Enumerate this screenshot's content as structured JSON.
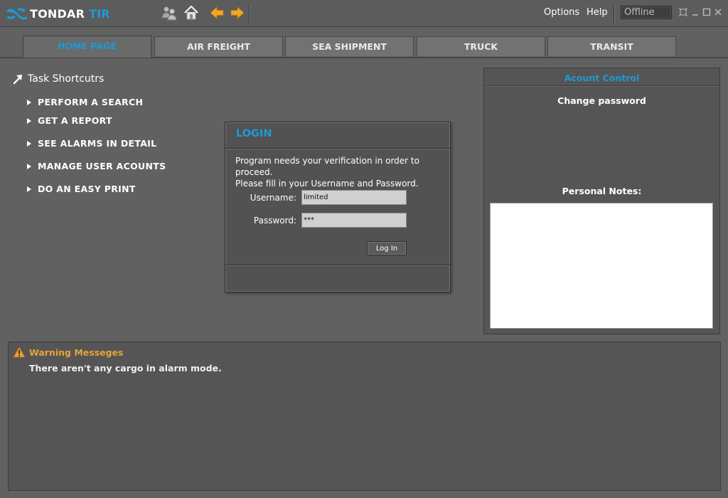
{
  "app": {
    "brand_primary": "TONDAR",
    "brand_secondary": "TIR"
  },
  "toolbar": {
    "icons": [
      "users-icon",
      "home-icon",
      "back-arrow-icon",
      "forward-arrow-icon"
    ]
  },
  "menu": {
    "options": "Options",
    "help": "Help"
  },
  "status": {
    "connection": "Offline"
  },
  "tabs": [
    {
      "label": "HOME PAGE",
      "active": true
    },
    {
      "label": "AIR FREIGHT",
      "active": false
    },
    {
      "label": "SEA SHIPMENT",
      "active": false
    },
    {
      "label": "TRUCK",
      "active": false
    },
    {
      "label": "TRANSIT",
      "active": false
    }
  ],
  "shortcuts": {
    "title": "Task Shortcutrs",
    "items": [
      {
        "label": "PERFORM A SEARCH"
      },
      {
        "label": "GET A REPORT"
      },
      {
        "label": "SEE ALARMS IN DETAIL"
      },
      {
        "label": "MANAGE USER ACOUNTS"
      },
      {
        "label": "DO AN EASY PRINT"
      }
    ]
  },
  "account": {
    "title": "Acount Control",
    "change_password": "Change password",
    "notes_label": "Personal Notes:",
    "notes_value": ""
  },
  "warnings": {
    "title": "Warning Messeges",
    "message": "There aren't any cargo in alarm mode."
  },
  "login": {
    "title": "LOGIN",
    "line1": "Program needs your verification in order to proceed.",
    "line2": "Please fill in your Username and Password.",
    "username_label": "Username:",
    "username_value": "limited",
    "password_label": "Password:",
    "password_value": "***",
    "button": "Log In"
  },
  "colors": {
    "accent": "#1d9ad6",
    "warning": "#e8a23a",
    "arrow": "#f5a623",
    "background": "#616161",
    "panel": "#555555"
  }
}
